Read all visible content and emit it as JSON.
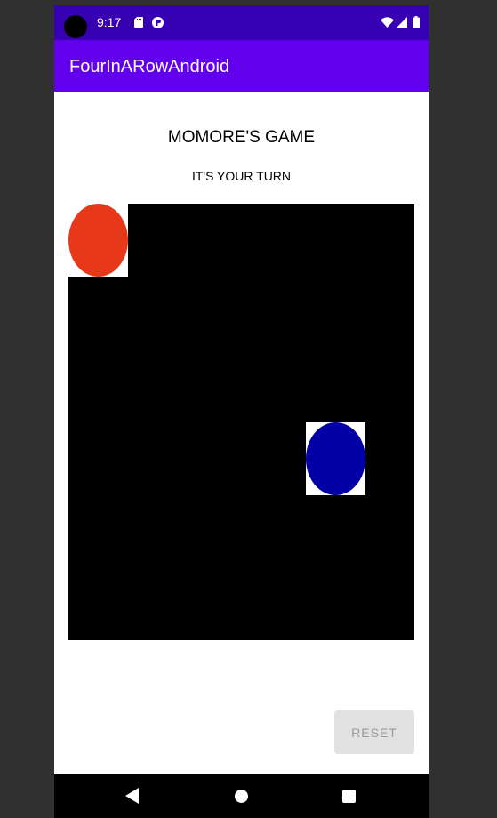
{
  "status_bar": {
    "time": "9:17",
    "icons": [
      "sd-card-icon",
      "notification-icon",
      "wifi-icon",
      "signal-icon",
      "battery-icon"
    ]
  },
  "app_bar": {
    "title": "FourInARowAndroid"
  },
  "game": {
    "title": "MOMORE'S GAME",
    "turn_text": "IT'S YOUR TURN",
    "pieces": [
      {
        "player": "red",
        "color": "#e8381a"
      },
      {
        "player": "blue",
        "color": "#0000a6"
      }
    ]
  },
  "reset_button": {
    "label": "RESET"
  },
  "nav_bar": {
    "icons": [
      "back-icon",
      "home-icon",
      "recents-icon"
    ]
  },
  "colors": {
    "status_bar": "#3700b3",
    "app_bar": "#6200ee",
    "board": "#000000",
    "red_piece": "#e8381a",
    "blue_piece": "#0000a6",
    "button_bg": "#e1e1e1",
    "button_text": "#9a9a9a"
  }
}
